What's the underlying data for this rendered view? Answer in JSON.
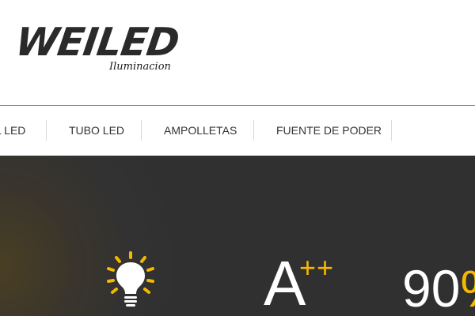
{
  "brand": {
    "name": "WEILED",
    "tagline": "Iluminacion"
  },
  "nav": {
    "items": [
      {
        "label": "L LED"
      },
      {
        "label": "TUBO LED"
      },
      {
        "label": "AMPOLLETAS"
      },
      {
        "label": "FUENTE DE PODER"
      }
    ]
  },
  "hero": {
    "rating_letter": "A",
    "rating_plus": "++",
    "percent_value": "90",
    "percent_sign": "%"
  },
  "colors": {
    "accent": "#f5b800",
    "hero_background": "#303030",
    "logo": "#2a2a2a"
  },
  "icons": {
    "bulb": "light-bulb-icon"
  }
}
